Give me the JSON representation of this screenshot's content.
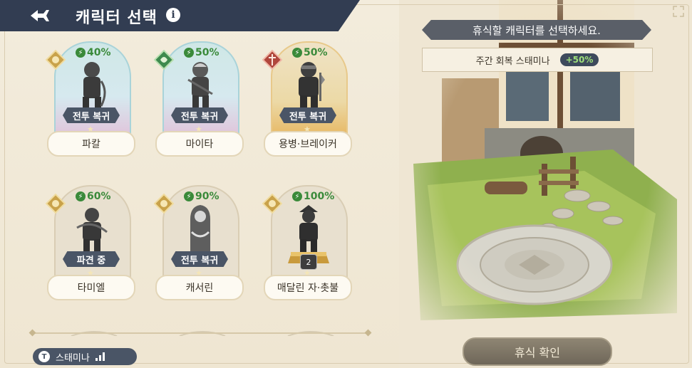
{
  "header": {
    "title": "캐릭터 선택",
    "info_symbol": "i",
    "back_icon": "back-arrow-icon"
  },
  "cards": [
    {
      "name": "파칼",
      "stamina": "40%",
      "status": "전투 복귀",
      "class": "sun-badge",
      "selected": true,
      "theme": "blue"
    },
    {
      "name": "마이타",
      "stamina": "50%",
      "status": "전투 복귀",
      "class": "leaf-badge",
      "selected": true,
      "theme": "blue"
    },
    {
      "name": "용병·브레이커",
      "stamina": "50%",
      "status": "전투 복귀",
      "class": "sword-badge",
      "selected": true,
      "theme": "gold"
    },
    {
      "name": "타미엘",
      "stamina": "60%",
      "status": "파견 중",
      "class": "sun-badge",
      "selected": false,
      "theme": "none"
    },
    {
      "name": "캐서린",
      "stamina": "90%",
      "status": "전투 복귀",
      "class": "sun-badge",
      "selected": false,
      "theme": "none"
    },
    {
      "name": "매달린 자·촛불",
      "stamina": "100%",
      "status": "",
      "level": "2",
      "class": "sun-badge",
      "selected": false,
      "theme": "none"
    }
  ],
  "sort_tab": {
    "label": "스태미나",
    "icon_letter": "T"
  },
  "panel": {
    "instruction": "휴식할 캐릭터를 선택하세요.",
    "weekly_label": "주간 회복 스태미나",
    "weekly_bonus": "+50%",
    "confirm_label": "휴식 확인"
  },
  "colors": {
    "header_bg": "#323d52",
    "stamina_green": "#3a8a3a",
    "bonus_green": "#9ee07a",
    "tag_bg": "#4a5566"
  }
}
